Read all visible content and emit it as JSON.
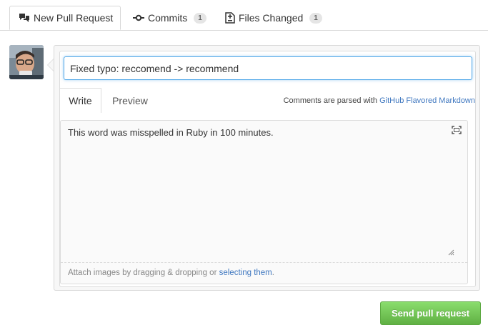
{
  "tabs": {
    "new_pull_request": {
      "label": "New Pull Request",
      "icon": "comment-discussion-icon"
    },
    "commits": {
      "label": "Commits",
      "count": "1",
      "icon": "git-commit-icon"
    },
    "files_changed": {
      "label": "Files Changed",
      "count": "1",
      "icon": "file-diff-icon"
    }
  },
  "form": {
    "title_value": "Fixed typo: reccomend -> recommend",
    "write_tab": "Write",
    "preview_tab": "Preview",
    "markdown_note_prefix": "Comments are parsed with ",
    "markdown_link": "GitHub Flavored Markdown",
    "body_value": "This word was misspelled in Ruby in 100 minutes.",
    "attach_prefix": "Attach images by dragging & dropping or ",
    "attach_link": "selecting them",
    "attach_suffix": ".",
    "submit_label": "Send pull request"
  },
  "colors": {
    "link": "#4078c0",
    "focus_border": "#51a7e8",
    "button_green_top": "#8add6d",
    "button_green_bottom": "#60b044"
  }
}
